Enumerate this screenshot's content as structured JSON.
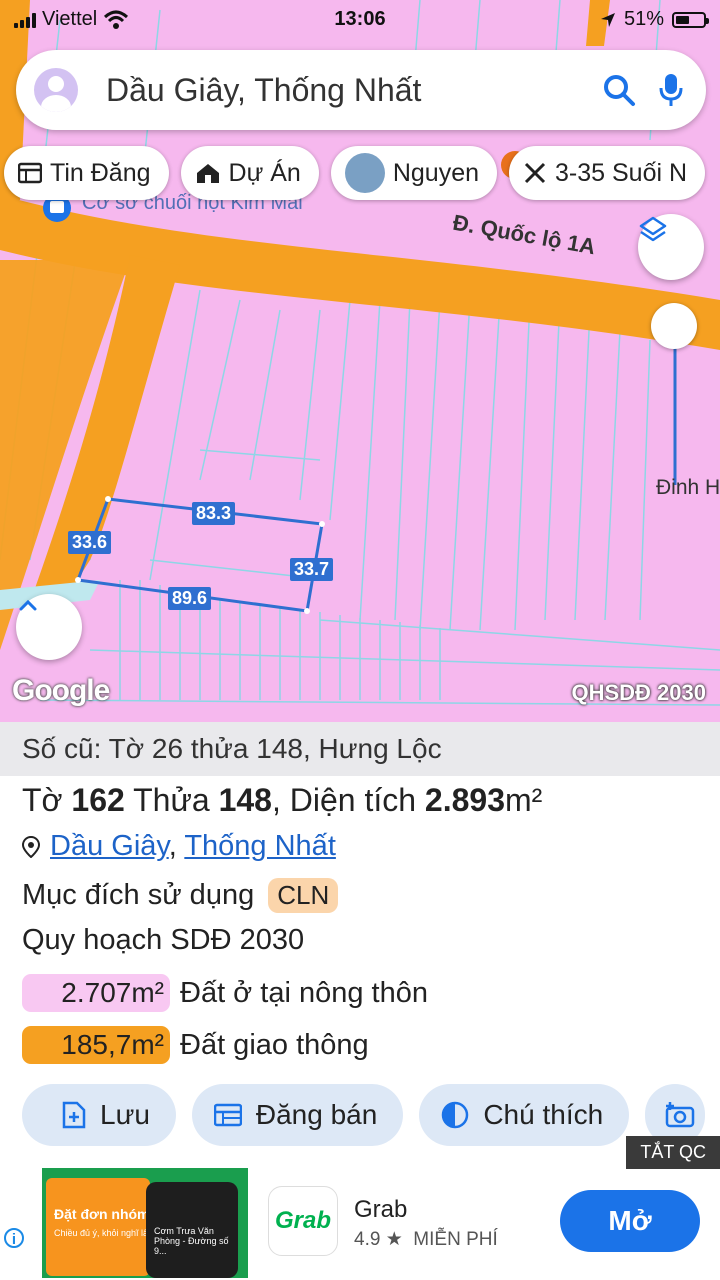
{
  "status_bar": {
    "carrier": "Viettel",
    "time": "13:06",
    "battery": "51%",
    "battery_level": 0.51
  },
  "search": {
    "query": "Dầu Giây, Thống Nhất"
  },
  "chips": [
    {
      "label": "Tin Đăng",
      "icon": "list-icon"
    },
    {
      "label": "Dự Án",
      "icon": "house-icon"
    },
    {
      "label": "Nguyen",
      "icon": "profile-photo"
    },
    {
      "label": "3-35 Suối N",
      "icon": "ruler-icon"
    }
  ],
  "map": {
    "road_label": "Đ. Quốc lộ 1A",
    "poi_label": "Cơ sở chuối hột Kim Mai",
    "place_label": "Đinh H",
    "dimensions": {
      "top": "83.3",
      "left": "33.6",
      "right": "33.7",
      "bottom": "89.6"
    },
    "attribution": "Google",
    "layer_name": "QHSDĐ 2030",
    "colors": {
      "land": "#f6b8ee",
      "road": "#f5a021",
      "parcel_outline": "#2f6fd0"
    }
  },
  "parcel": {
    "old_info": "Số cũ: Tờ 26 thửa 148, Hưng Lộc",
    "sheet_label": "Tờ ",
    "sheet": "162",
    "plot_label": " Thửa ",
    "plot": "148",
    "area_label": ", Diện tích ",
    "area": "2.893",
    "area_unit": "m²",
    "location_parts": [
      "Dầu Giây",
      "Thống Nhất"
    ],
    "location_sep": ", ",
    "usage_label": "Mục đích sử dụng",
    "usage_code": "CLN",
    "plan_label": "Quy hoạch SDĐ 2030",
    "zones": [
      {
        "area": "2.707m²",
        "label": "Đất ở tại nông thôn",
        "color": "#f8c8f2"
      },
      {
        "area": "185,7m²",
        "label": "Đất giao thông",
        "color": "#f5a021"
      }
    ]
  },
  "actions": [
    {
      "label": "Lưu",
      "icon": "add-file-icon"
    },
    {
      "label": "Đăng bán",
      "icon": "table-icon"
    },
    {
      "label": "Chú thích",
      "icon": "contrast-icon"
    }
  ],
  "ad": {
    "close_label": "TẮT QC",
    "banner_title": "Đặt đơn nhóm",
    "banner_subtitle": "Chiều đủ ý, khỏi nghĩ lâu",
    "phone_text": "Cơm Trưa Văn Phòng - Đường số 9...",
    "app_logo_text": "Grab",
    "app_name": "Grab",
    "rating": "4.9 ★",
    "price": "MIỄN PHÍ",
    "cta": "Mở"
  }
}
